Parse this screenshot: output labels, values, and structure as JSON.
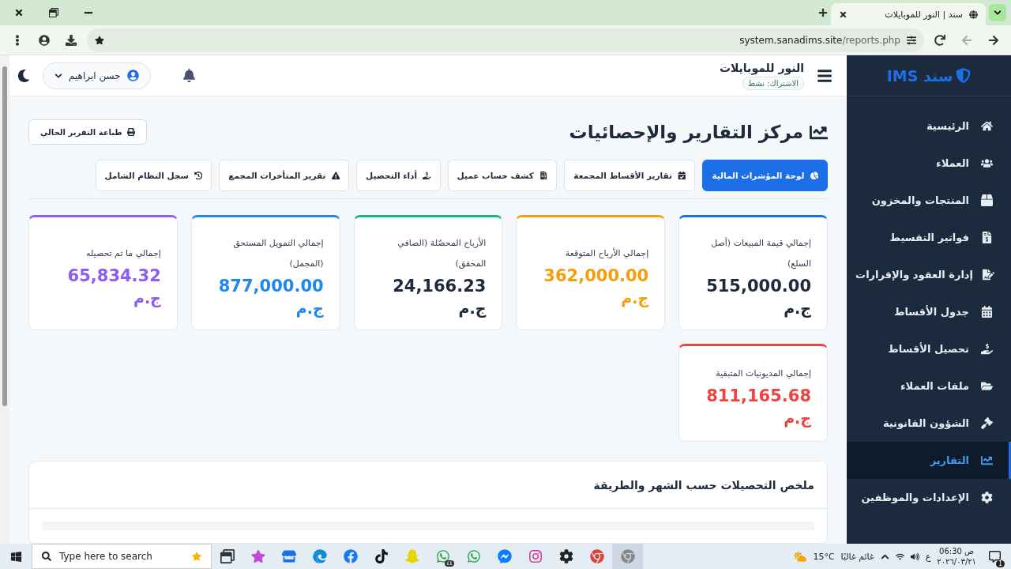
{
  "browser": {
    "tab_title": "سند | النور للموبايلات",
    "url_host": "system.sanadims.site",
    "url_path": "/reports.php"
  },
  "sidebar": {
    "logo": "سند IMS",
    "items": [
      {
        "label": "الرئيسية",
        "selected": false
      },
      {
        "label": "العملاء",
        "selected": false
      },
      {
        "label": "المنتجات والمخزون",
        "selected": false
      },
      {
        "label": "فواتير التقسيط",
        "selected": false
      },
      {
        "label": "إدارة العقود والإقرارات",
        "selected": false
      },
      {
        "label": "جدول الأقساط",
        "selected": false
      },
      {
        "label": "تحصيل الأقساط",
        "selected": false
      },
      {
        "label": "ملفات العملاء",
        "selected": false
      },
      {
        "label": "الشؤون القانونية",
        "selected": false
      },
      {
        "label": "التقارير",
        "selected": true
      },
      {
        "label": "الإعدادات والموظفين",
        "selected": false
      }
    ]
  },
  "header": {
    "store_name": "النور للموبايلات",
    "subscription": "الاشتراك: نشط",
    "user": "حسن ابراهيم"
  },
  "page": {
    "title": "مركز التقارير والإحصائيات",
    "print_button": "طباعة التقرير الحالي",
    "tabs": [
      {
        "label": "لوحة المؤشرات المالية",
        "selected": true
      },
      {
        "label": "تقارير الأقساط المجمعة",
        "selected": false
      },
      {
        "label": "كشف حساب عميل",
        "selected": false
      },
      {
        "label": "أداء التحصيل",
        "selected": false
      },
      {
        "label": "تقرير المتأخرات المجمع",
        "selected": false
      },
      {
        "label": "سجل النظام الشامل",
        "selected": false
      }
    ],
    "cards": [
      {
        "label": "إجمالي قيمة المبيعات (أصل السلع)",
        "value": "515,000.00",
        "currency": "ج.م",
        "color": "#1d6fe8",
        "accent_value": false
      },
      {
        "label": "إجمالي الأرباح المتوقعة",
        "value": "362,000.00",
        "currency": "ج.م",
        "color": "#f59e0b",
        "accent_value": true
      },
      {
        "label": "الأرباح المحصّلة (الصافي المحقق)",
        "value": "24,166.23",
        "currency": "ج.م",
        "color": "#10b981",
        "accent_value": false
      },
      {
        "label": "إجمالي التمويل المستحق (المجمل)",
        "value": "877,000.00",
        "currency": "ج.م",
        "color": "#1e88f0",
        "accent_value": true
      },
      {
        "label": "إجمالي ما تم تحصيله",
        "value": "65,834.32",
        "currency": "ج.م",
        "color": "#8b5cf6",
        "accent_value": true
      },
      {
        "label": "إجمالي المديونيات المتبقية",
        "value": "811,165.68",
        "currency": "ج.م",
        "color": "#ef4444",
        "accent_value": true
      }
    ],
    "section_title": "ملخص التحصيلات حسب الشهر والطريقة"
  },
  "taskbar": {
    "search_placeholder": "Type here to search",
    "whatsapp_badge": "٤٤",
    "temperature": "15°C",
    "weather": "غائم غالبًا",
    "language": "ع",
    "time": "06:30 ص",
    "date": "٢٠٢٦/٠٣/٢١",
    "notifications": "1"
  }
}
